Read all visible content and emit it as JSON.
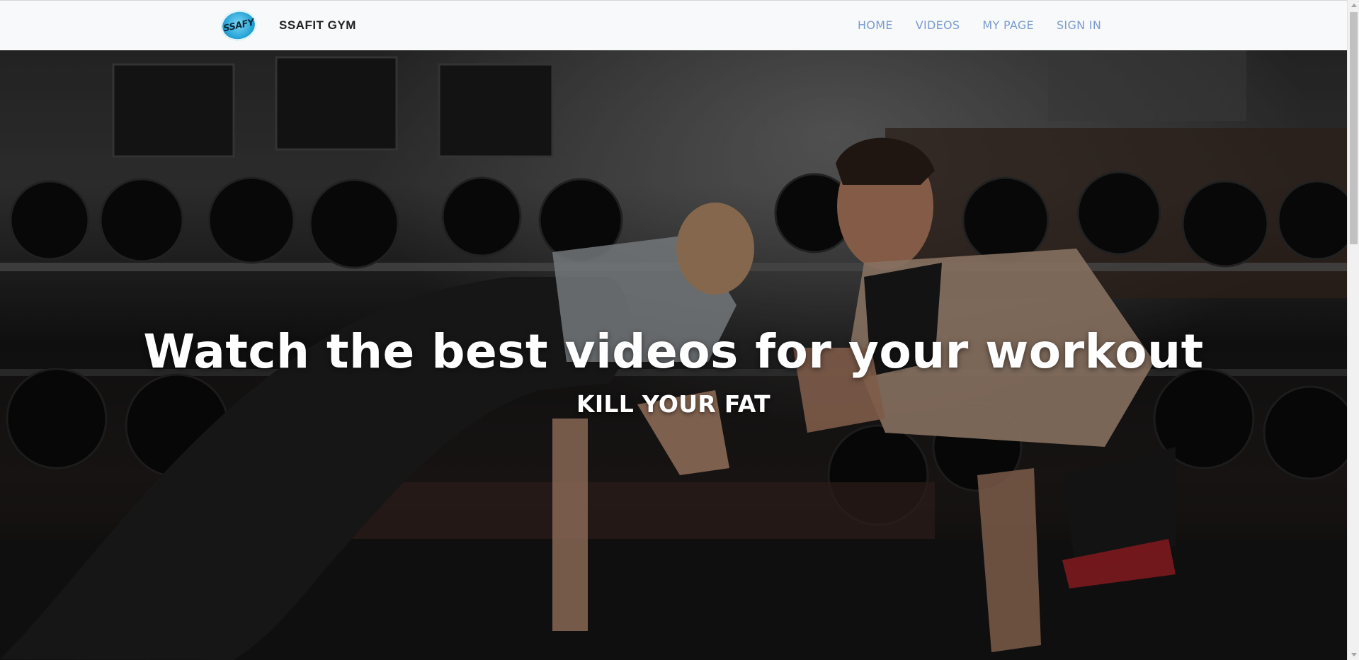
{
  "navbar": {
    "logo_text": "SSAFY",
    "brand_name": "SSAFIT GYM",
    "links": [
      {
        "label": "HOME"
      },
      {
        "label": "VIDEOS"
      },
      {
        "label": "MY PAGE"
      },
      {
        "label": "SIGN IN"
      }
    ]
  },
  "hero": {
    "title": "Watch the best videos for your workout",
    "subtitle": "KILL YOUR FAT",
    "image_subject": "man and woman doing plank arm wrestle in gym with dumbbell racks"
  },
  "colors": {
    "navbar_bg": "#f8f9fa",
    "nav_link": "#7a9ccf",
    "brand_text": "#222222",
    "hero_text": "#ffffff",
    "logo_blue": "#2aa6d9"
  },
  "icons": [
    "ssafy-logo-icon"
  ]
}
